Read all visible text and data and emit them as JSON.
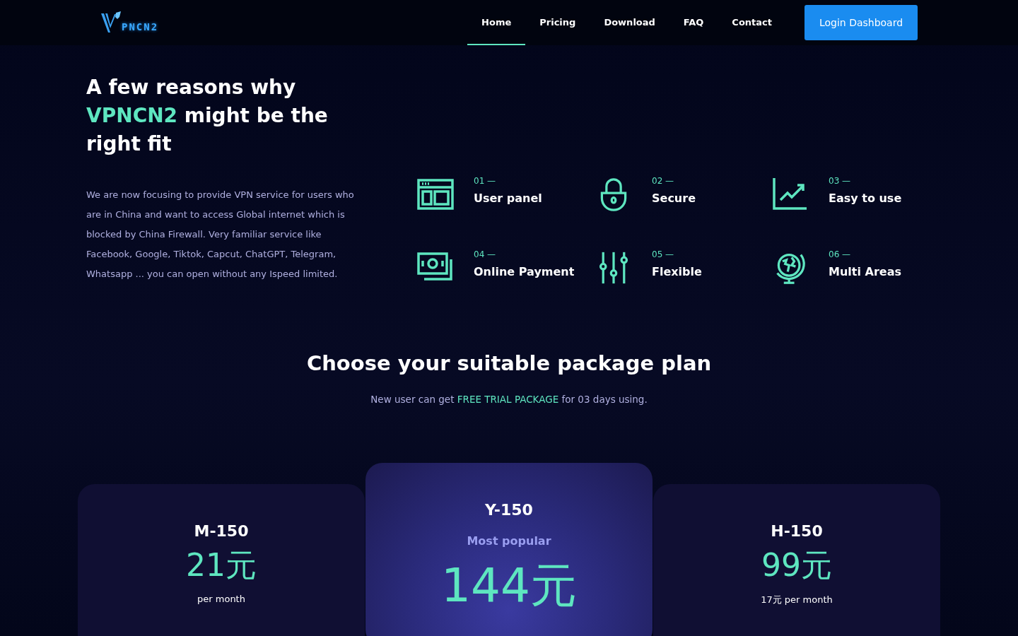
{
  "logo": {
    "text": "PNCN2"
  },
  "nav": [
    {
      "label": "Home",
      "selected": true
    },
    {
      "label": "Pricing",
      "selected": false
    },
    {
      "label": "Download",
      "selected": false
    },
    {
      "label": "FAQ",
      "selected": false
    },
    {
      "label": "Contact",
      "selected": false
    }
  ],
  "login_button": "Login Dashboard",
  "intro": {
    "heading_before": "A few reasons why",
    "heading_highlight": "VPNCN2",
    "heading_after": "might be the right fit",
    "text": "We are now focusing to provide VPN service for users who are in China and want to access Global internet which is blocked by China Firewall. Very familiar service like Facebook, Google, Tiktok, Capcut, ChatGPT, Telegram, Whatsapp ... you can open without any Ispeed limited."
  },
  "features": [
    {
      "number": "01 —",
      "title": "User panel",
      "kind": "panel"
    },
    {
      "number": "02 —",
      "title": "Secure",
      "kind": "lock"
    },
    {
      "number": "03 —",
      "title": "Easy to use",
      "kind": "chart"
    },
    {
      "number": "04 —",
      "title": "Online Payment",
      "kind": "money"
    },
    {
      "number": "05 —",
      "title": "Flexible",
      "kind": "sliders"
    },
    {
      "number": "06 —",
      "title": "Multi Areas",
      "kind": "globe"
    }
  ],
  "plans_section": {
    "title": "Choose your suitable package plan",
    "subtitle_before": "New user can get",
    "subtitle_highlight": "FREE TRIAL PACKAGE",
    "subtitle_after": "for 03 days using."
  },
  "plans": [
    {
      "name": "M-150",
      "price": "21元",
      "note": "per month",
      "featured": false
    },
    {
      "name": "Y-150",
      "tag": "Most popular",
      "price": "144元",
      "featured": true
    },
    {
      "name": "H-150",
      "price": "99元",
      "note": "17元 per month",
      "featured": false
    }
  ]
}
